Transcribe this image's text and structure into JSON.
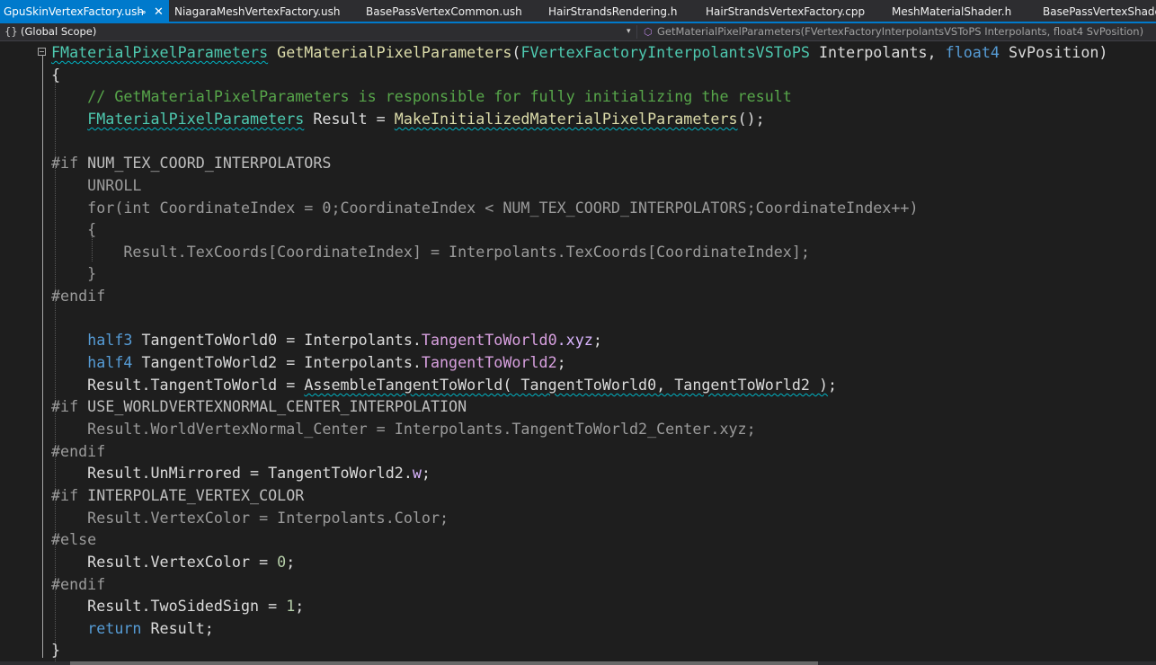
{
  "tabs": [
    {
      "label": "GpuSkinVertexFactory.ush",
      "active": true
    },
    {
      "label": "NiagaraMeshVertexFactory.ush"
    },
    {
      "label": "BasePassVertexCommon.ush"
    },
    {
      "label": "HairStrandsRendering.h"
    },
    {
      "label": "HairStrandsVertexFactory.cpp"
    },
    {
      "label": "MeshMaterialShader.h"
    },
    {
      "label": "BasePassVertexShader.u"
    }
  ],
  "tab_controls": {
    "pin_icon": "pin-icon",
    "close_icon": "close-icon",
    "pin_glyph": "⊸",
    "close_glyph": "✕"
  },
  "nav": {
    "scope_icon_glyph": "{}",
    "scope": "(Global Scope)",
    "member": "GetMaterialPixelParameters(FVertexFactoryInterpolantsVSToPS Interpolants, float4 SvPosition)",
    "dropdown_glyph": "▾",
    "member_icon_glyph": "⬡"
  },
  "code": {
    "l1": {
      "t1": "FMaterialPixelParameters",
      "t2": " ",
      "t3": "GetMaterialPixelParameters",
      "t4": "(",
      "t5": "FVertexFactoryInterpolantsVSToPS",
      "t6": " Interpolants, ",
      "t7": "float4",
      "t8": " SvPosition)"
    },
    "l2": {
      "t1": "{"
    },
    "l3": {
      "t1": "    // GetMaterialPixelParameters is responsible for fully initializing the result"
    },
    "l4": {
      "t1": "    ",
      "t2": "FMaterialPixelParameters",
      "t3": " Result = ",
      "t4": "MakeInitializedMaterialPixelParameters",
      "t5": "();"
    },
    "l5": {
      "t1": ""
    },
    "l6": {
      "t1": "#if",
      "t2": " NUM_TEX_COORD_INTERPOLATORS"
    },
    "l7": {
      "t1": "    UNROLL"
    },
    "l8": {
      "t1": "    for(int CoordinateIndex = 0;CoordinateIndex < NUM_TEX_COORD_INTERPOLATORS;CoordinateIndex++)"
    },
    "l9": {
      "t1": "    {"
    },
    "l10": {
      "t1": "        Result.TexCoords[CoordinateIndex] = Interpolants.TexCoords[CoordinateIndex];"
    },
    "l11": {
      "t1": "    }"
    },
    "l12": {
      "t1": "#endif"
    },
    "l13": {
      "t1": ""
    },
    "l14": {
      "t1": "    ",
      "t2": "half3",
      "t3": " TangentToWorld0 = Interpolants.",
      "t4": "TangentToWorld0",
      "t5": ".xyz",
      "t6": ";"
    },
    "l15": {
      "t1": "    ",
      "t2": "half4",
      "t3": " TangentToWorld2 = Interpolants.",
      "t4": "TangentToWorld2",
      "t5": ";"
    },
    "l16": {
      "t1": "    Result.TangentToWorld = ",
      "t2": "AssembleTangentToWorld( TangentToWorld0, TangentToWorld2 )",
      "t3": ";"
    },
    "l17": {
      "t1": "#if",
      "t2": " USE_WORLDVERTEXNORMAL_CENTER_INTERPOLATION"
    },
    "l18": {
      "t1": "    Result.WorldVertexNormal_Center = Interpolants.TangentToWorld2_Center.xyz;"
    },
    "l19": {
      "t1": "#endif"
    },
    "l20": {
      "t1": "    Result.UnMirrored = TangentToWorld2.",
      "t2": "w",
      "t3": ";"
    },
    "l21": {
      "t1": "#if",
      "t2": " INTERPOLATE_VERTEX_COLOR"
    },
    "l22": {
      "t1": "    Result.VertexColor = Interpolants.Color;"
    },
    "l23": {
      "t1": "#else"
    },
    "l24": {
      "t1": "    Result.VertexColor = ",
      "t2": "0",
      "t3": ";"
    },
    "l25": {
      "t1": "#endif"
    },
    "l26": {
      "t1": "    Result.TwoSidedSign = ",
      "t2": "1",
      "t3": ";"
    },
    "l27": {
      "t1": "    ",
      "t2": "return",
      "t3": " Result;"
    },
    "l28": {
      "t1": "}"
    }
  },
  "colors": {
    "background": "#1e1e1e",
    "accent": "#007acc",
    "comment": "#57a64a",
    "type": "#4ec9b0",
    "function": "#dcdcaa",
    "keyword": "#569cd6",
    "preprocessor": "#9b9b9b",
    "number": "#b5cea8",
    "member": "#dab5ff"
  }
}
